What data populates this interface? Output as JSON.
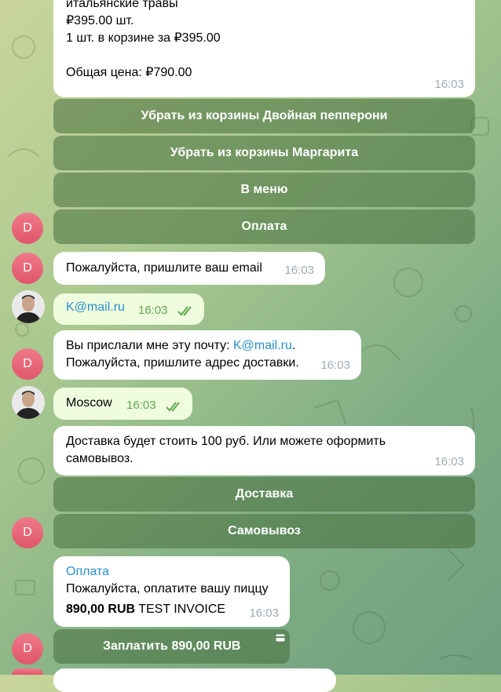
{
  "colors": {
    "accent": "#2a8fd0",
    "avatar": "#e5606f",
    "outgoing_bubble": "#effdde",
    "keyboard_button": "#5b8a55"
  },
  "avatars": {
    "bot_letter": "D"
  },
  "messages": {
    "cart": {
      "lines": [
        "итальянские травы",
        "₽395.00 шт.",
        "1 шт. в корзине за ₽395.00",
        "",
        "Общая цена: ₽790.00"
      ],
      "time": "16:03"
    },
    "cart_buttons": [
      "Убрать из корзины Двойная пепперони",
      "Убрать из корзины Маргарита",
      "В меню",
      "Оплата"
    ],
    "ask_email": {
      "text": "Пожалуйста, пришлите ваш email",
      "time": "16:03"
    },
    "user_email": {
      "text": "K@mail.ru",
      "time": "16:03"
    },
    "confirm_email": {
      "prefix": "Вы прислали мне эту почту: ",
      "email": "K@mail.ru",
      "suffix": ".",
      "line2": "Пожалуйста, пришлите адрес доставки.",
      "time": "16:03"
    },
    "user_city": {
      "text": "Moscow",
      "time": "16:03"
    },
    "delivery": {
      "line1": "Доставка будет стоить 100 руб. Или можете оформить",
      "line2": "самовывоз.",
      "time": "16:03"
    },
    "delivery_buttons": [
      "Доставка",
      "Самовывоз"
    ],
    "invoice": {
      "title": "Оплата",
      "desc": "Пожалуйста, оплатите вашу пиццу",
      "amount": "890,00 RUB",
      "label": "TEST INVOICE",
      "time": "16:03"
    },
    "pay_button": {
      "label": "Заплатить 890,00 RUB",
      "icon": "card-icon"
    }
  }
}
